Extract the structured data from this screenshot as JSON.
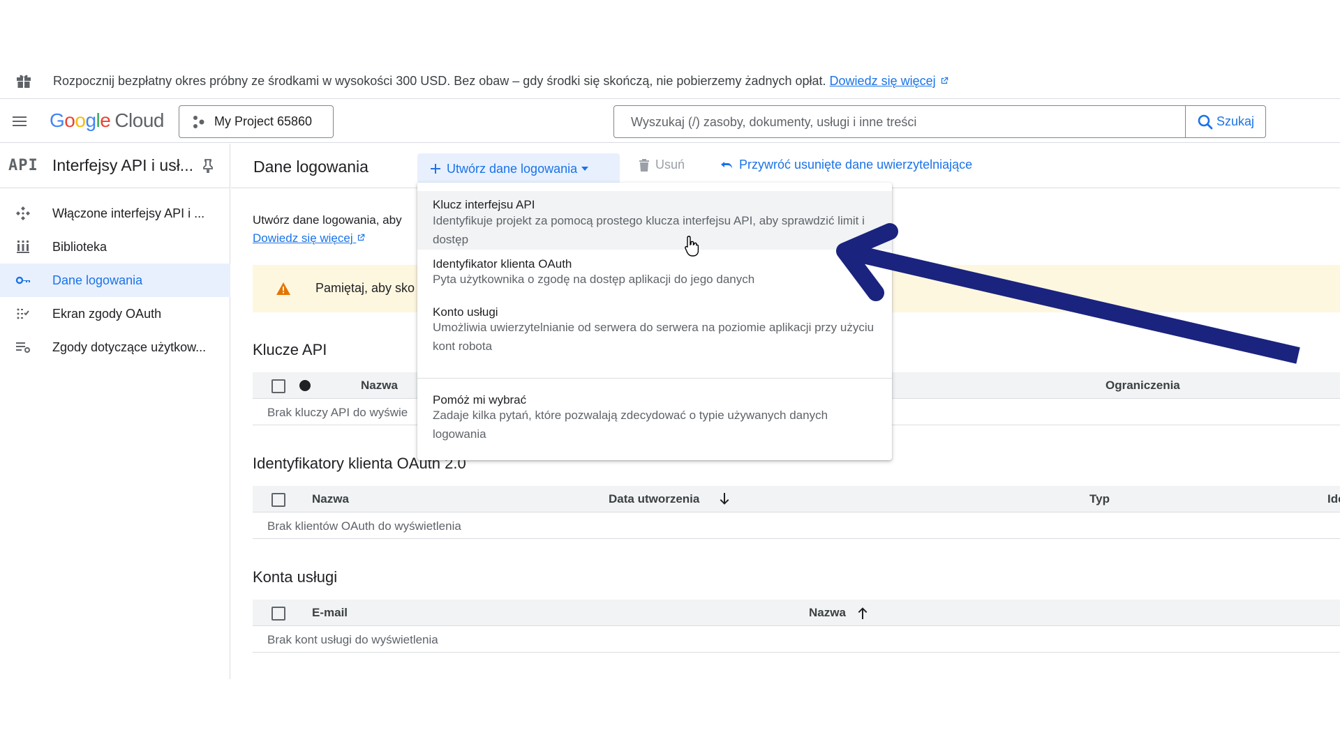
{
  "banner": {
    "text": "Rozpocznij bezpłatny okres próbny ze środkami w wysokości 300 USD. Bez obaw – gdy środki się skończą, nie pobierzemy żadnych opłat.",
    "link": "Dowiedz się więcej"
  },
  "header": {
    "logo_google": [
      "G",
      "o",
      "o",
      "g",
      "l",
      "e"
    ],
    "logo_cloud": "Cloud",
    "project": "My Project 65860",
    "search_placeholder": "Wyszukaj (/) zasoby, dokumenty, usługi i inne treści",
    "search_button": "Szukaj"
  },
  "sidebar": {
    "badge": "API",
    "title": "Interfejsy API i usł...",
    "items": [
      {
        "label": "Włączone interfejsy API i ...",
        "icon": "apis-icon"
      },
      {
        "label": "Biblioteka",
        "icon": "library-icon"
      },
      {
        "label": "Dane logowania",
        "icon": "key-icon",
        "active": true
      },
      {
        "label": "Ekran zgody OAuth",
        "icon": "consent-icon"
      },
      {
        "label": "Zgody dotyczące użytkow...",
        "icon": "settings-list-icon"
      }
    ]
  },
  "toolbar": {
    "title": "Dane logowania",
    "create": "Utwórz dane logowania",
    "delete": "Usuń",
    "restore": "Przywróć usunięte dane uwierzytelniające"
  },
  "content": {
    "intro": "Utwórz dane logowania, aby",
    "learn_more": "Dowiedz się więcej",
    "warning": "Pamiętaj, aby sko",
    "api_keys": {
      "title": "Klucze API",
      "columns": [
        "Nazwa",
        "Ograniczenia"
      ],
      "empty": "Brak kluczy API do wyświe"
    },
    "oauth": {
      "title": "Identyfikatory klienta OAuth 2.0",
      "columns": [
        "Nazwa",
        "Data utworzenia",
        "Typ",
        "Ide"
      ],
      "empty": "Brak klientów OAuth do wyświetlenia"
    },
    "service": {
      "title": "Konta usługi",
      "columns": [
        "E-mail",
        "Nazwa"
      ],
      "empty": "Brak kont usługi do wyświetlenia"
    }
  },
  "dropdown": {
    "items": [
      {
        "title": "Klucz interfejsu API",
        "desc": "Identyfikuje projekt za pomocą prostego klucza interfejsu API, aby sprawdzić limit i dostęp"
      },
      {
        "title": "Identyfikator klienta OAuth",
        "desc": "Pyta użytkownika o zgodę na dostęp aplikacji do jego danych"
      },
      {
        "title": "Konto usługi",
        "desc": "Umożliwia uwierzytelnianie od serwera do serwera na poziomie aplikacji przy użyciu kont robota"
      },
      {
        "title": "Pomóż mi wybrać",
        "desc": "Zadaje kilka pytań, które pozwalają zdecydować o typie używanych danych logowania"
      }
    ]
  },
  "colors": {
    "accent": "#1a73e8",
    "arrow": "#1a237e",
    "warning_bg": "#fef7e0",
    "warning_icon": "#e37400",
    "active_bg": "#e8f0fe"
  }
}
